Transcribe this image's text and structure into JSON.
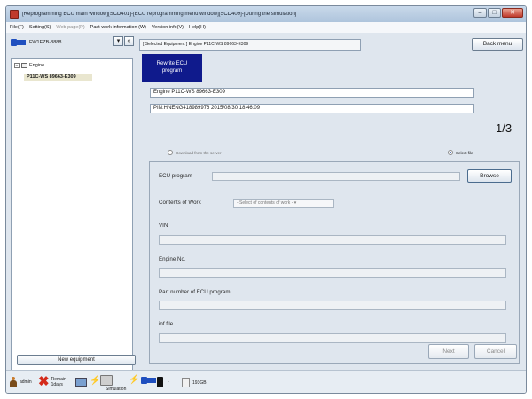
{
  "window": {
    "title": "[Reprogramming ECU main window][SCD401]-[ECU reprogramming menu window][SCD409]-[During the simulation]"
  },
  "menu": [
    {
      "label": "File(F)",
      "disabled": false
    },
    {
      "label": "Setting(S)",
      "disabled": false
    },
    {
      "label": "Web page(P)",
      "disabled": true
    },
    {
      "label": "Past work information (W)",
      "disabled": false
    },
    {
      "label": "Version info(V)",
      "disabled": false
    },
    {
      "label": "Help(H)",
      "disabled": false
    }
  ],
  "left": {
    "equipment_label": "FW1EZB-8888",
    "tree": {
      "root": "Engine",
      "child": "P11C-WS 89663-E309"
    },
    "new_equipment": "New equipment"
  },
  "right": {
    "selected_equipment": "[ Selected Equipment ] Engine P11C-WS 89663-E309",
    "back_menu": "Back menu",
    "tab_label_line1": "Rewrite ECU",
    "tab_label_line2": "program",
    "engine_info": "Engine P11C-WS 89663-E309",
    "pin_info": "PIN:HNENG418989976 2015/08/30 18:46:09",
    "page_counter": "1/3",
    "download_option": "Download from the server",
    "select_file_option": "Select file",
    "ecu_program_label": "ECU program",
    "browse": "Browse",
    "contents_of_work_label": "Contents of Work",
    "contents_select": "- Select of contents of work -",
    "vin_label": "VIN",
    "engine_no_label": "Engine No.",
    "part_number_label": "Part number of ECU program",
    "inf_file_label": "inf file",
    "next": "Next",
    "cancel": "Cancel"
  },
  "status": {
    "user": "admin",
    "remain_line1": "Remain",
    "remain_line2": "1days",
    "simulation": "Simulation",
    "dash": "-",
    "disk": "193GB"
  }
}
